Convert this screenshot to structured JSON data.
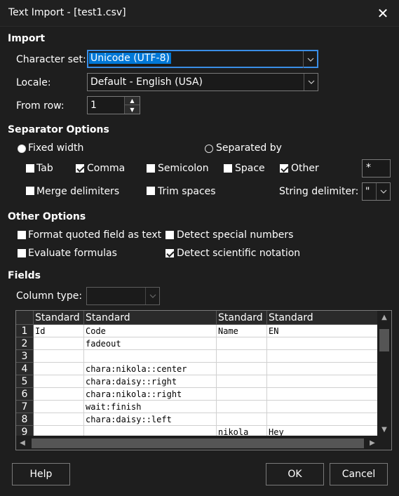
{
  "window": {
    "title": "Text Import - [test1.csv]"
  },
  "import": {
    "heading": "Import",
    "charset_label": "Character set:",
    "charset_value": "Unicode (UTF-8)",
    "locale_label": "Locale:",
    "locale_value": "Default - English (USA)",
    "from_row_label": "From row:",
    "from_row_value": "1"
  },
  "separator": {
    "heading": "Separator Options",
    "fixed_width": "Fixed width",
    "separated_by": "Separated by",
    "tab": "Tab",
    "comma": "Comma",
    "semicolon": "Semicolon",
    "space": "Space",
    "other": "Other",
    "other_value": "*",
    "merge_delimiters": "Merge delimiters",
    "trim_spaces": "Trim spaces",
    "string_delimiter_label": "String delimiter:",
    "string_delimiter_value": "\""
  },
  "other_options": {
    "heading": "Other Options",
    "format_quoted": "Format quoted field as text",
    "detect_special": "Detect special numbers",
    "evaluate_formulas": "Evaluate formulas",
    "detect_scientific": "Detect scientific notation"
  },
  "fields": {
    "heading": "Fields",
    "column_type_label": "Column type:",
    "column_type_value": "",
    "headers": [
      "Standard",
      "Standard",
      "Standard",
      "Standard"
    ],
    "row_numbers": [
      "1",
      "2",
      "3",
      "4",
      "5",
      "6",
      "7",
      "8",
      "9"
    ],
    "rows": [
      [
        "Id",
        "Code",
        "Name",
        "EN"
      ],
      [
        "",
        "fadeout",
        "",
        ""
      ],
      [
        "",
        "",
        "",
        ""
      ],
      [
        "",
        "chara:nikola::center",
        "",
        ""
      ],
      [
        "",
        "chara:daisy::right",
        "",
        ""
      ],
      [
        "",
        "chara:nikola::right",
        "",
        ""
      ],
      [
        "",
        "wait:finish",
        "",
        ""
      ],
      [
        "",
        "chara:daisy::left",
        "",
        ""
      ],
      [
        "",
        "",
        "nikola",
        "Hey"
      ]
    ]
  },
  "buttons": {
    "help": "Help",
    "ok": "OK",
    "cancel": "Cancel"
  },
  "colors": {
    "accent": "#0078d7",
    "background": "#1e1e1e"
  }
}
